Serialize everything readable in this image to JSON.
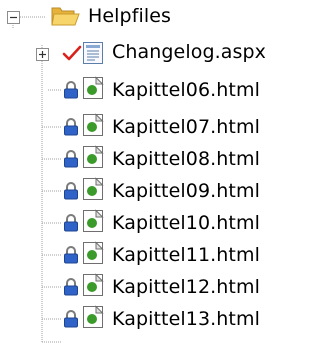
{
  "tree": {
    "root": {
      "label": "Helpfiles",
      "expanded": true,
      "icon": "folder-open-icon"
    },
    "children": [
      {
        "label": "Changelog.aspx",
        "icon": "aspx-page-icon",
        "status": "checked-out",
        "expandable": true
      },
      {
        "label": "Kapittel06.html",
        "icon": "html-page-icon",
        "status": "locked"
      },
      {
        "label": "Kapittel07.html",
        "icon": "html-page-icon",
        "status": "locked"
      },
      {
        "label": "Kapittel08.html",
        "icon": "html-page-icon",
        "status": "locked"
      },
      {
        "label": "Kapittel09.html",
        "icon": "html-page-icon",
        "status": "locked"
      },
      {
        "label": "Kapittel10.html",
        "icon": "html-page-icon",
        "status": "locked"
      },
      {
        "label": "Kapittel11.html",
        "icon": "html-page-icon",
        "status": "locked"
      },
      {
        "label": "Kapittel12.html",
        "icon": "html-page-icon",
        "status": "locked"
      },
      {
        "label": "Kapittel13.html",
        "icon": "html-page-icon",
        "status": "locked"
      }
    ]
  },
  "colors": {
    "connector": "#a0a0a0",
    "folder": "#f5c74a",
    "checkmark": "#d9221c",
    "lock": "#2f63c8",
    "page_green": "#3a9a2a"
  }
}
